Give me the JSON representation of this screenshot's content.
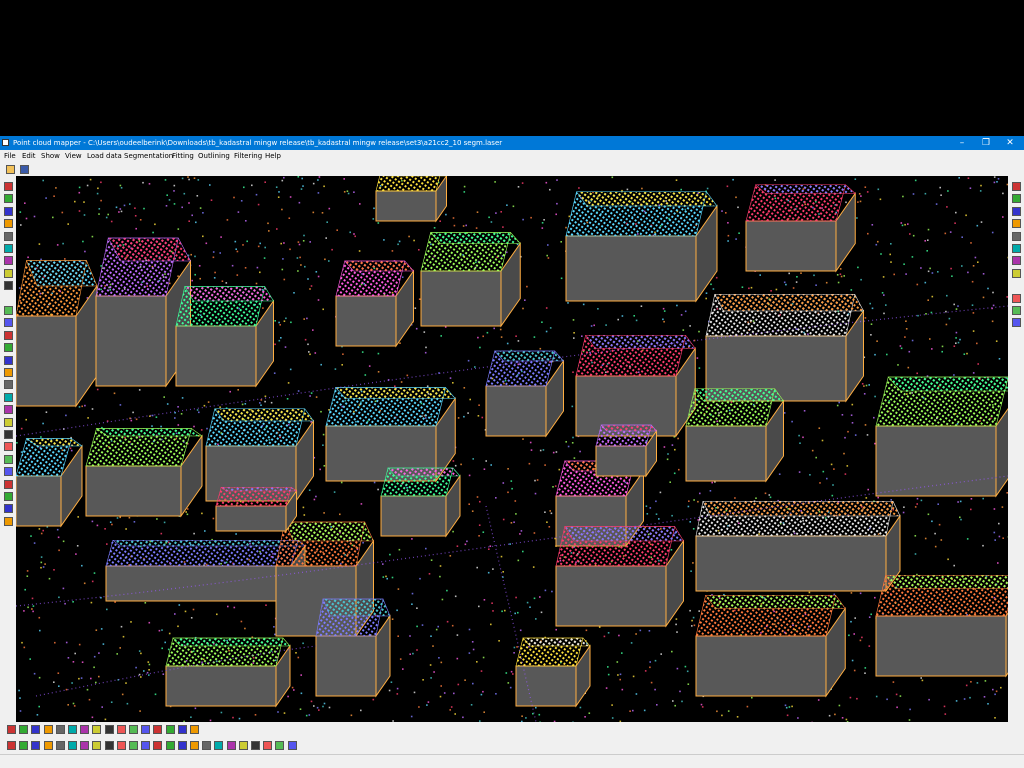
{
  "window": {
    "title": "Point cloud mapper - C:\\Users\\oudeelberink\\Downloads\\tb_kadastral mingw release\\tb_kadastral mingw release\\set3\\a21cc2_10 segm.laser"
  },
  "menu": {
    "items": [
      {
        "label": "File"
      },
      {
        "label": "Edit"
      },
      {
        "label": "Show"
      },
      {
        "label": "View"
      },
      {
        "label": "Load data"
      },
      {
        "label": "Segmentation"
      },
      {
        "label": "Fitting"
      },
      {
        "label": "Outlining"
      },
      {
        "label": "Filtering"
      },
      {
        "label": "Help"
      }
    ]
  },
  "window_controls": {
    "minimize": "–",
    "maximize": "❐",
    "close": "✕"
  },
  "colors": {
    "titlebar": "#0078d7",
    "roof_palette": [
      "#ff9a3c",
      "#c06cff",
      "#9cff5a",
      "#5ad8ff",
      "#ff3c6e",
      "#3cff9a",
      "#ffe13c",
      "#7c7cff",
      "#ff5ae0",
      "#e8e8e8",
      "#46c8c8",
      "#ff7a3c"
    ],
    "wall": "#585858",
    "wall_outline": "#ffae42"
  },
  "icons": {
    "toolbar_top": [
      "open-folder-icon",
      "save-icon"
    ],
    "left": [
      "select-icon",
      "points-icon",
      "red-square-icon",
      "fire-icon",
      "building-icon",
      "grid-icon",
      "tin-icon",
      "green-plane-icon",
      "layers-icon",
      "spacer",
      "circle-icon",
      "pen-icon",
      "plus-icon",
      "wand-icon",
      "crop-icon",
      "red-plane-icon",
      "split-icon",
      "merge-icon",
      "fill-icon",
      "rotate-icon",
      "move-icon",
      "triangle-icon",
      "flag-icon",
      "green-flag-icon",
      "polygon-icon",
      "outline-icon",
      "erase-icon",
      "zoom-icon"
    ],
    "right": [
      "view-top-icon",
      "view-front-icon",
      "view-side-icon",
      "view-3d-icon",
      "reset-view-icon",
      "color-segment-icon",
      "color-height-icon",
      "color-intensity-icon",
      "spacer",
      "zoom-in-icon",
      "zoom-out-icon",
      "fit-icon"
    ],
    "bottom1": [
      "blank-icon",
      "box-icon",
      "grid-icon",
      "mesh-icon",
      "rect-icon",
      "frame-icon",
      "line-icon",
      "target-icon",
      "circle-icon",
      "dot-icon",
      "hole-icon",
      "dot2-icon",
      "square-icon",
      "cross-icon",
      "minus-icon",
      "arrow-icon"
    ],
    "bottom2": [
      "select-all-icon",
      "deselect-icon",
      "delete-icon",
      "undo-icon",
      "redo-icon",
      "cut-icon",
      "copy-icon",
      "paste-icon",
      "grid-icon",
      "frame-icon",
      "line-icon",
      "pause-icon",
      "stop-icon",
      "flag-icon",
      "target-icon",
      "record-icon",
      "marker-icon",
      "building-icon",
      "green-icon",
      "red-icon",
      "mesh-icon",
      "segment-icon",
      "check-icon",
      "flag2-icon"
    ]
  }
}
